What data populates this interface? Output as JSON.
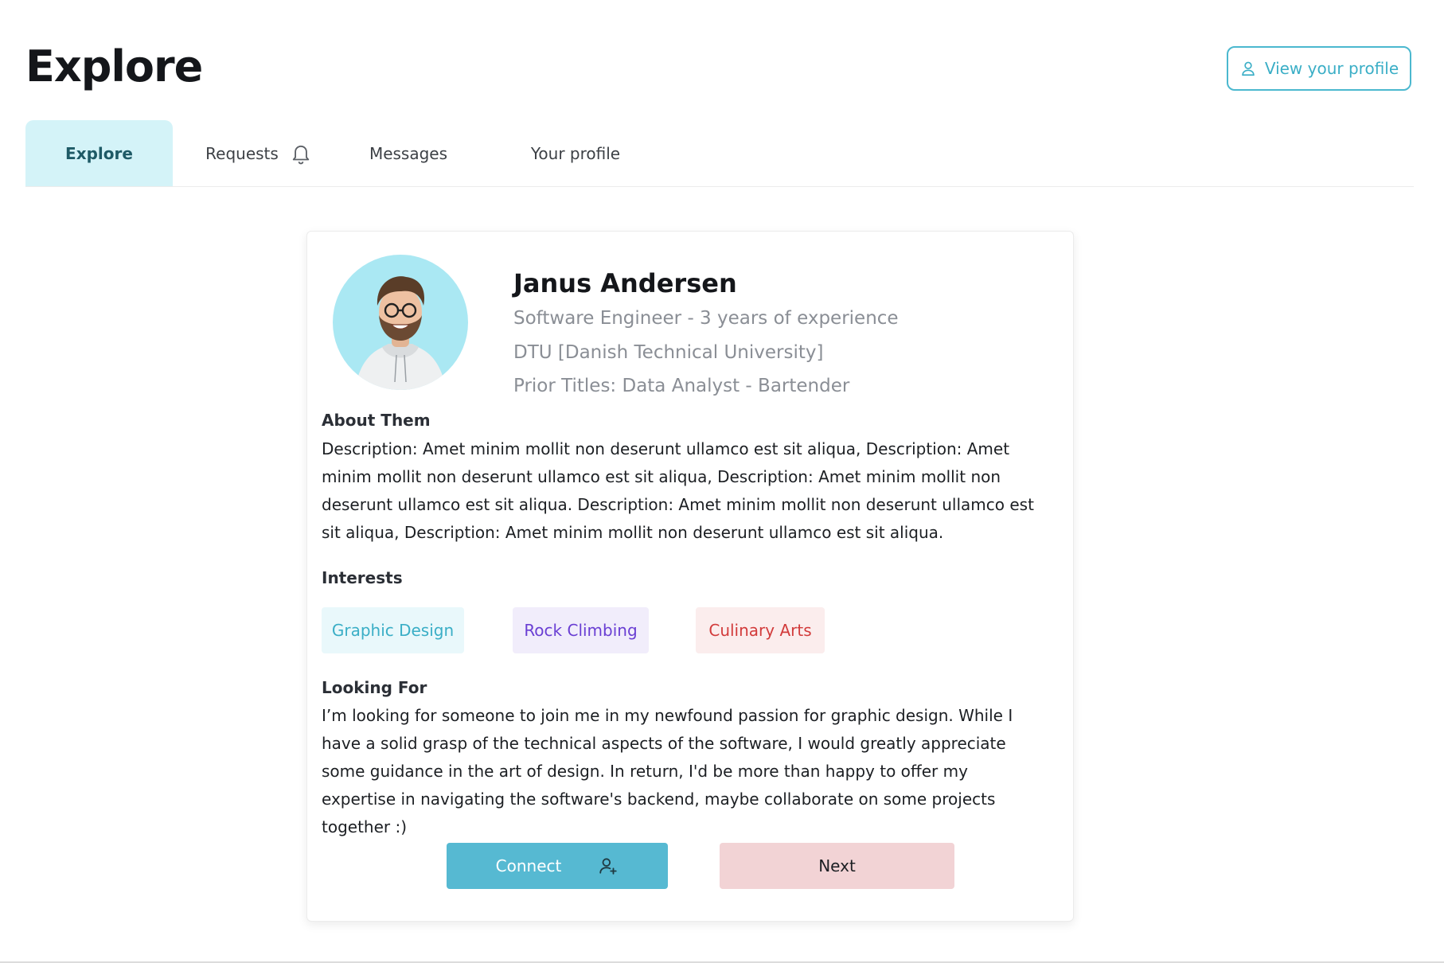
{
  "header": {
    "title": "Explore",
    "view_profile_label": "View your profile"
  },
  "tabs": [
    {
      "label": "Explore",
      "active": true
    },
    {
      "label": "Requests",
      "icon": "bell-icon"
    },
    {
      "label": "Messages"
    },
    {
      "label": "Your profile"
    }
  ],
  "profile": {
    "name": "Janus Andersen",
    "role": "Software Engineer - 3 years of experience",
    "education": "DTU [Danish Technical University]",
    "prior_titles": "Prior Titles: Data Analyst - Bartender",
    "about_title": "About Them",
    "about_text": "Description: Amet minim mollit non deserunt ullamco est sit aliqua, Description: Amet minim mollit non deserunt ullamco est sit aliqua, Description: Amet minim mollit non deserunt ullamco est sit aliqua. Description: Amet minim mollit non deserunt ullamco est sit aliqua, Description: Amet minim mollit non deserunt ullamco est sit aliqua.",
    "interests_title": "Interests",
    "interests": [
      "Graphic Design",
      "Rock Climbing",
      "Culinary Arts"
    ],
    "looking_for_title": "Looking For",
    "looking_for_text": "I’m looking for someone to join me in my newfound passion for graphic design. While I have a solid grasp of the technical aspects of the software, I would greatly appreciate some guidance in the art of design. In return, I'd be more than happy to offer my expertise in navigating the software's backend, maybe collaborate on some projects together :)"
  },
  "actions": {
    "connect_label": "Connect",
    "next_label": "Next"
  },
  "colors": {
    "accent": "#4bb8cf",
    "tab_active_bg": "#d4f3f8",
    "connect_bg": "#56b9d2",
    "next_bg": "#f2d3d5",
    "chip_graphic_bg": "#e9f8fb",
    "chip_graphic_text": "#3aaec6",
    "chip_rock_bg": "#f1edfb",
    "chip_rock_text": "#6a3fd3",
    "chip_culinary_bg": "#fbeded",
    "chip_culinary_text": "#d23b3b"
  }
}
